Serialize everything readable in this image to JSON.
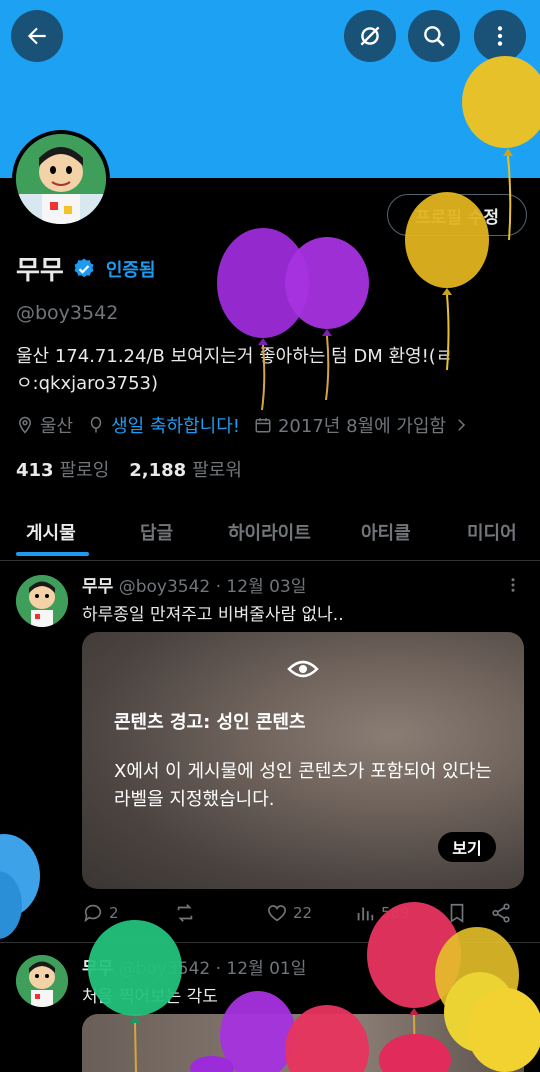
{
  "header": {
    "back_icon": "arrow-left-icon",
    "grok_icon": "grok-icon",
    "search_icon": "search-icon",
    "more_icon": "more-vertical-icon"
  },
  "profile": {
    "edit_label": "프로필 수정",
    "name": "무무",
    "verified_label": "인증됨",
    "handle": "@boy3542",
    "bio": "울산  174.71.24/B  보여지는거 좋아하는 텀  DM 환영!(ㄹㅇ:qkxjaro3753)",
    "location": "울산",
    "birthday": "생일 축하합니다!",
    "joined": "2017년 8월에 가입함",
    "following_count": "413",
    "following_label": "팔로잉",
    "followers_count": "2,188",
    "followers_label": "팔로워"
  },
  "tabs": [
    "게시물",
    "답글",
    "하이라이트",
    "아티클",
    "미디어"
  ],
  "posts": [
    {
      "name": "무무",
      "handle": "@boy3542",
      "date": "· 12월 03일",
      "text": "하루종일 만져주고 비벼줄사람 없나..",
      "warning_title": "콘텐츠 경고: 성인 콘텐츠",
      "warning_body": "X에서 이 게시물에 성인 콘텐츠가 포함되어 있다는 라벨을 지정했습니다.",
      "show_label": "보기",
      "replies": "2",
      "likes": "22",
      "views": "589"
    },
    {
      "name": "무무",
      "handle": "@boy3542",
      "date": "· 12월 01일",
      "text": "처음 찍어보는 각도"
    }
  ],
  "colors": {
    "banner": "#1da1f2",
    "accent": "#1d9bf0",
    "background": "#000000",
    "muted": "#71767b"
  }
}
